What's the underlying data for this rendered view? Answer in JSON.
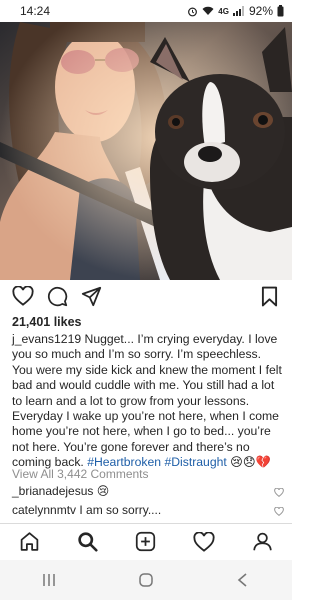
{
  "status_bar": {
    "time": "14:24",
    "network": "4G",
    "battery": "92%"
  },
  "post": {
    "likes": "21,401 likes",
    "username": "j_evans1219",
    "caption": " Nugget... I’m crying everyday. I love you so much and I’m so sorry. I’m speechless. You were my side kick and knew the moment I felt bad and would cuddle with me. You still had a lot to learn and a lot to grow from your lessons. Everyday I wake up you’re not here, when I come home you’re not here, when I go to bed... you’re not here. You’re gone forever and there’s no coming back. ",
    "hashtag1": "#Heartbroken",
    "hashtag2": "#Distraught",
    "caption_emoji": "😢😞💔",
    "view_all": "View All 3,442 Comments"
  },
  "comments": [
    {
      "username": "_brianadejesus",
      "text": " 😢"
    },
    {
      "username": "catelynnmtv",
      "text": " I am so sorry...."
    }
  ],
  "icons": {
    "like": "heart-icon",
    "comment": "comment-icon",
    "share": "send-icon",
    "save": "bookmark-icon",
    "nav": [
      "home-icon",
      "search-icon",
      "add-icon",
      "activity-icon",
      "profile-icon"
    ]
  },
  "colors": {
    "hashtag": "#1f5fa8",
    "muted": "#8e8e8e",
    "text": "#262626"
  }
}
